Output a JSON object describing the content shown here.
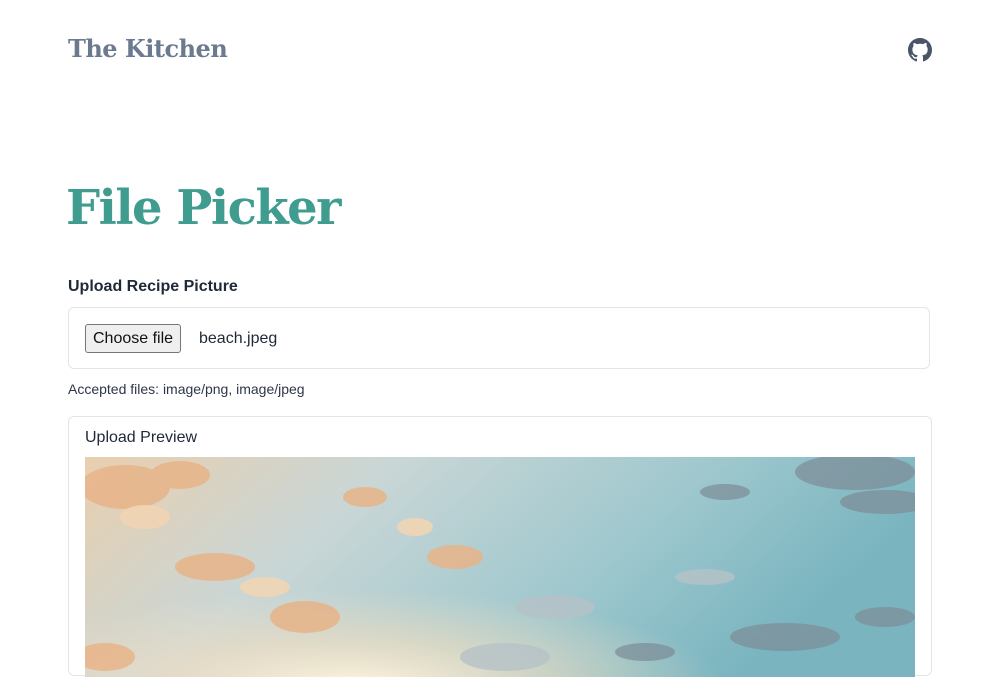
{
  "header": {
    "brand": "The Kitchen",
    "github_icon": "github-icon"
  },
  "page": {
    "title": "File Picker"
  },
  "upload": {
    "label": "Upload Recipe Picture",
    "choose_button": "Choose file",
    "file_name": "beach.jpeg",
    "help_text": "Accepted files: image/png, image/jpeg"
  },
  "preview": {
    "label": "Upload Preview",
    "image": "beach-photo"
  }
}
